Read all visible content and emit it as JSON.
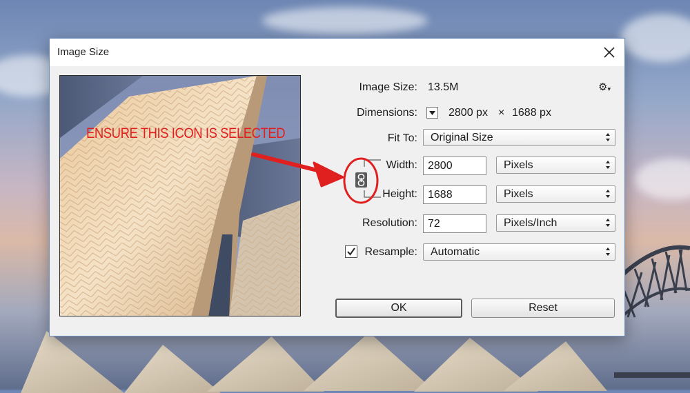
{
  "dialog": {
    "title": "Image Size",
    "close_icon": "close-icon"
  },
  "image_size": {
    "label": "Image Size:",
    "value": "13.5M"
  },
  "settings": {
    "icon": "gear-icon"
  },
  "dimensions": {
    "label": "Dimensions:",
    "width": "2800 px",
    "separator": "×",
    "height": "1688 px"
  },
  "fit_to": {
    "label": "Fit To:",
    "value": "Original Size"
  },
  "width": {
    "label": "Width:",
    "value": "2800",
    "unit": "Pixels"
  },
  "height": {
    "label": "Height:",
    "value": "1688",
    "unit": "Pixels"
  },
  "resolution": {
    "label": "Resolution:",
    "value": "72",
    "unit": "Pixels/Inch"
  },
  "resample": {
    "label": "Resample:",
    "checked": true,
    "value": "Automatic"
  },
  "buttons": {
    "ok": "OK",
    "reset": "Reset"
  },
  "constrain": {
    "icon": "chain-link-icon"
  },
  "annotation": {
    "text": "ENSURE THIS ICON IS SELECTED",
    "color": "#e01f1f"
  }
}
